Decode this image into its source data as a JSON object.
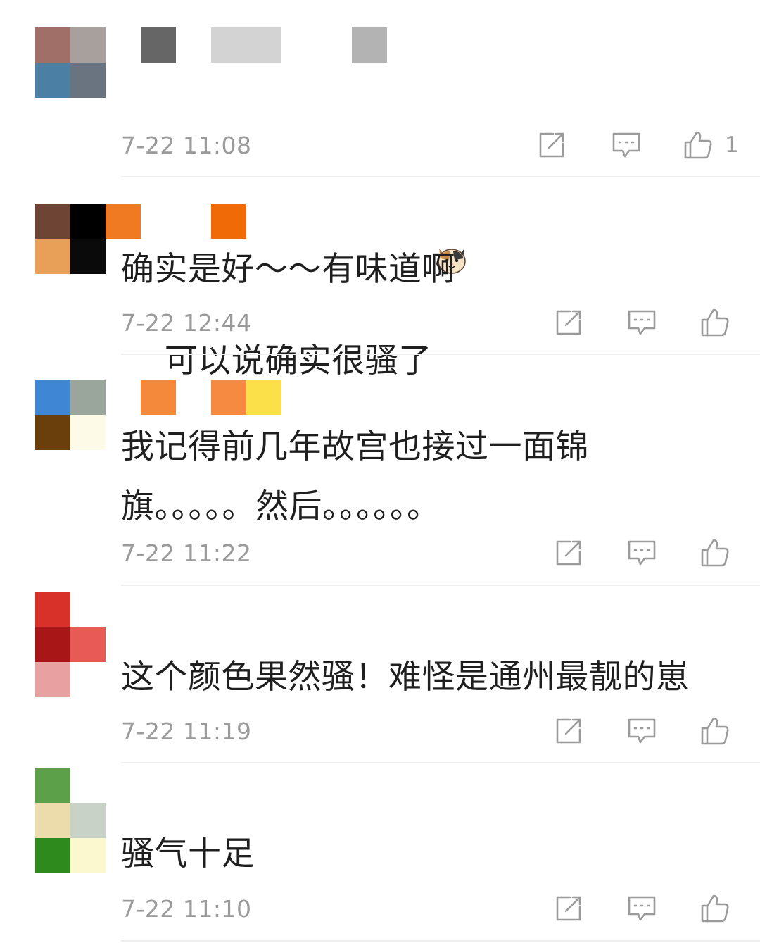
{
  "comments": [
    {
      "text": "可以说确实很骚了",
      "emoji": "cat-face-emoji",
      "time": "7-22 11:08",
      "likes": "1",
      "avatar_colors": [
        "#a07068",
        "#a8a09c",
        "#4b7fa3",
        "#6a7380"
      ]
    },
    {
      "text": "确实是好～～有味道啊",
      "time": "7-22 12:44",
      "likes": "",
      "avatar_colors": [
        "#6e4534",
        "#000000",
        "#e8a058",
        "#0a0a0a"
      ]
    },
    {
      "text": "我记得前几年故宫也接过一面锦旗。。。。。然后。。。。。。",
      "time": "7-22 11:22",
      "likes": "",
      "avatar_colors": [
        "#3f86d4",
        "#9aa59c",
        "#6b3f0c",
        "#fdfbe8"
      ]
    },
    {
      "text": "这个颜色果然骚！难怪是通州最靓的崽",
      "time": "7-22 11:19",
      "likes": "",
      "avatar_colors": [
        "#d8312a",
        "#ffffff",
        "#a81617",
        "#e85a55"
      ]
    },
    {
      "text": "骚气十足",
      "time": "7-22 11:10",
      "likes": "",
      "avatar_colors": [
        "#5ca049",
        "#ffffff",
        "#ecdcab",
        "#c8d2c6"
      ]
    }
  ],
  "icons": {
    "repost": "repost-icon",
    "reply": "comment-icon",
    "like": "thumbs-up-icon"
  }
}
